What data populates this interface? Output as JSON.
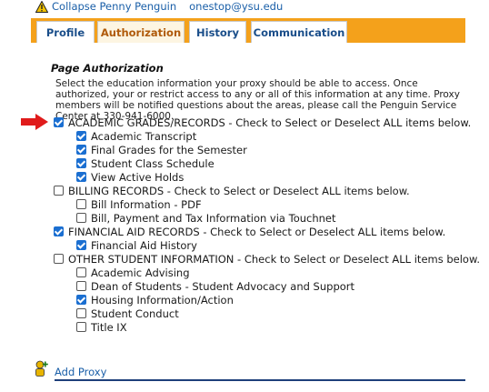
{
  "header": {
    "collapse_label": "Collapse Penny Penguin",
    "email": "onestop@ysu.edu"
  },
  "tabs": [
    {
      "label": "Profile",
      "active": false
    },
    {
      "label": "Authorization",
      "active": true
    },
    {
      "label": "History",
      "active": false
    },
    {
      "label": "Communication",
      "active": false
    }
  ],
  "section": {
    "title": "Page Authorization",
    "description": "Select the education information your proxy should be able to access. Once authorized, your or restrict access to any or all of this information at any time. Proxy members will be notified questions about the areas, please call the Penguin Service Center at 330-941-6000."
  },
  "groups": [
    {
      "label": "ACADEMIC GRADES/RECORDS - Check to Select or Deselect ALL items below.",
      "checked": true,
      "items": [
        {
          "label": "Academic Transcript",
          "checked": true
        },
        {
          "label": "Final Grades for the Semester",
          "checked": true
        },
        {
          "label": "Student Class Schedule",
          "checked": true
        },
        {
          "label": "View Active Holds",
          "checked": true
        }
      ]
    },
    {
      "label": "BILLING RECORDS - Check to Select or Deselect ALL items below.",
      "checked": false,
      "items": [
        {
          "label": "Bill Information - PDF",
          "checked": false
        },
        {
          "label": "Bill, Payment and Tax Information via Touchnet",
          "checked": false
        }
      ]
    },
    {
      "label": "FINANCIAL AID RECORDS - Check to Select or Deselect ALL items below.",
      "checked": true,
      "items": [
        {
          "label": "Financial Aid History",
          "checked": true
        }
      ]
    },
    {
      "label": "OTHER STUDENT INFORMATION - Check to Select or Deselect ALL items below.",
      "checked": false,
      "items": [
        {
          "label": "Academic Advising",
          "checked": false
        },
        {
          "label": "Dean of Students - Student Advocacy and Support",
          "checked": false
        },
        {
          "label": "Housing Information/Action",
          "checked": true
        },
        {
          "label": "Student Conduct",
          "checked": false
        },
        {
          "label": "Title IX",
          "checked": false
        }
      ]
    }
  ],
  "footer": {
    "add_proxy_label": "Add Proxy"
  },
  "colors": {
    "tab_bar": "#f4a11b",
    "link": "#1a5fa8",
    "checkbox_checked": "#1b6fd1",
    "arrow": "#e01b1b"
  }
}
